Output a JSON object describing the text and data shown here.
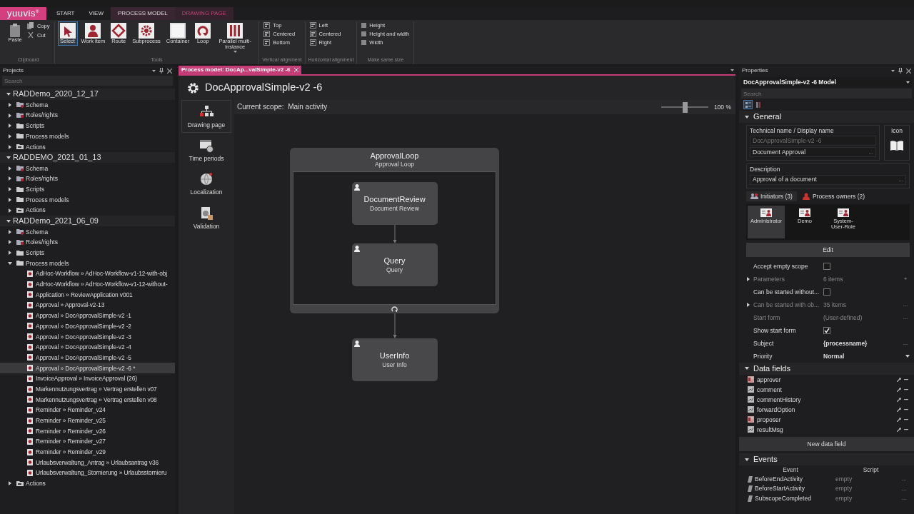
{
  "logo": "yuuvis$^{®}$",
  "ribbon_tabs": [
    {
      "label": "START",
      "kind": "plain",
      "selected": false
    },
    {
      "label": "VIEW",
      "kind": "plain",
      "selected": false
    },
    {
      "label": "PROCESS MODEL",
      "kind": "context",
      "selected": false
    },
    {
      "label": "DRAWING PAGE",
      "kind": "context",
      "selected": true
    }
  ],
  "ribbon_groups": [
    {
      "label": "Clipboard",
      "items": [
        {
          "label": "Paste",
          "kind": "large",
          "selected": false
        },
        {
          "label": "Copy",
          "kind": "small",
          "selected": false
        },
        {
          "label": "Cut",
          "kind": "small",
          "selected": false
        }
      ]
    },
    {
      "label": "Tools",
      "items": [
        {
          "label": "Select",
          "kind": "large",
          "selected": true
        },
        {
          "label": "Work item",
          "kind": "large",
          "selected": false
        },
        {
          "label": "Route",
          "kind": "large",
          "selected": false
        },
        {
          "label": "Subprocess",
          "kind": "large",
          "selected": false
        },
        {
          "label": "Container",
          "kind": "large",
          "selected": false
        },
        {
          "label": "Loop",
          "kind": "large",
          "selected": false
        },
        {
          "label": "Parallel multi-instance",
          "kind": "dropdown",
          "selected": false
        }
      ]
    },
    {
      "label": "Vertical alignment",
      "items": [
        {
          "label": "Top",
          "kind": "small",
          "selected": false
        },
        {
          "label": "Centered",
          "kind": "small",
          "selected": false
        },
        {
          "label": "Bottom",
          "kind": "small",
          "selected": false
        }
      ]
    },
    {
      "label": "Horizontal alignment",
      "items": [
        {
          "label": "Left",
          "kind": "small",
          "selected": false
        },
        {
          "label": "Centered",
          "kind": "small",
          "selected": false
        },
        {
          "label": "Right",
          "kind": "small",
          "selected": false
        }
      ]
    },
    {
      "label": "Make same size",
      "items": [
        {
          "label": "Height",
          "kind": "small",
          "selected": false
        },
        {
          "label": "Height and width",
          "kind": "small",
          "selected": false
        },
        {
          "label": "Width",
          "kind": "small",
          "selected": false
        }
      ]
    }
  ],
  "projects_panel": {
    "title": "Projects",
    "search_placeholder": "Search",
    "tree": [
      {
        "label": "RADDemo_2020_12_17",
        "kind": "project",
        "expanded": true,
        "selected": false,
        "children": [
          {
            "label": "Schema",
            "kind": "schema",
            "expanded": false,
            "selected": false
          },
          {
            "label": "Roles/rights",
            "kind": "roles",
            "expanded": false,
            "selected": false
          },
          {
            "label": "Scripts",
            "kind": "folder",
            "expanded": false,
            "selected": false
          },
          {
            "label": "Process models",
            "kind": "folder",
            "expanded": false,
            "selected": false
          },
          {
            "label": "Actions",
            "kind": "actions",
            "expanded": false,
            "selected": false
          }
        ]
      },
      {
        "label": "RADDEMO_2021_01_13",
        "kind": "project",
        "expanded": true,
        "selected": false,
        "children": [
          {
            "label": "Schema",
            "kind": "schema",
            "expanded": false,
            "selected": false
          },
          {
            "label": "Roles/rights",
            "kind": "roles",
            "expanded": false,
            "selected": false
          },
          {
            "label": "Scripts",
            "kind": "folder",
            "expanded": false,
            "selected": false
          },
          {
            "label": "Process models",
            "kind": "folder",
            "expanded": false,
            "selected": false
          },
          {
            "label": "Actions",
            "kind": "actions",
            "expanded": false,
            "selected": false
          }
        ]
      },
      {
        "label": "RADDemo_2021_06_09",
        "kind": "project",
        "expanded": true,
        "selected": false,
        "children": [
          {
            "label": "Schema",
            "kind": "schema",
            "expanded": false,
            "selected": false
          },
          {
            "label": "Roles/rights",
            "kind": "roles",
            "expanded": false,
            "selected": false
          },
          {
            "label": "Scripts",
            "kind": "folder",
            "expanded": false,
            "selected": false
          },
          {
            "label": "Process models",
            "kind": "folder",
            "expanded": true,
            "selected": false,
            "children": [
              {
                "label": "AdHoc-Workflow » AdHoc-Workflow-v1-12-with-obj",
                "kind": "model",
                "selected": false
              },
              {
                "label": "AdHoc-Workflow » AdHoc-Workflow-v1-12-without-",
                "kind": "model",
                "selected": false
              },
              {
                "label": "Application » ReviewApplication v001",
                "kind": "model",
                "selected": false
              },
              {
                "label": "Approval » Approval-v2-13",
                "kind": "model",
                "selected": false
              },
              {
                "label": "Approval » DocApprovalSimple-v2 -1",
                "kind": "model",
                "selected": false
              },
              {
                "label": "Approval » DocApprovalSimple-v2 -2",
                "kind": "model",
                "selected": false
              },
              {
                "label": "Approval » DocApprovalSimple-v2 -3",
                "kind": "model",
                "selected": false
              },
              {
                "label": "Approval » DocApprovalSimple-v2 -4",
                "kind": "model",
                "selected": false
              },
              {
                "label": "Approval » DocApprovalSimple-v2 -5",
                "kind": "model",
                "selected": false
              },
              {
                "label": "Approval » DocApprovalSimple-v2 -6 *",
                "kind": "model",
                "selected": true
              },
              {
                "label": "InvoiceApproval » InvoiceApproval (26)",
                "kind": "model",
                "selected": false
              },
              {
                "label": "Markennutzungsvertrag » Vertrag erstellen v07",
                "kind": "model",
                "selected": false
              },
              {
                "label": "Markennutzungsvertrag » Vertrag erstellen v08",
                "kind": "model",
                "selected": false
              },
              {
                "label": "Reminder » Reminder_v24",
                "kind": "model",
                "selected": false
              },
              {
                "label": "Reminder » Reminder_v25",
                "kind": "model",
                "selected": false
              },
              {
                "label": "Reminder » Reminder_v26",
                "kind": "model",
                "selected": false
              },
              {
                "label": "Reminder » Reminder_v27",
                "kind": "model",
                "selected": false
              },
              {
                "label": "Reminder » Reminder_v29",
                "kind": "model",
                "selected": false
              },
              {
                "label": "Urlaubsverwaltung_Antrag » Urlaubsantrag v36",
                "kind": "model",
                "selected": false
              },
              {
                "label": "Urlaubsverwaltung_Stornierung » Urlaubsstornieru",
                "kind": "model",
                "selected": false
              }
            ]
          },
          {
            "label": "Actions",
            "kind": "actions",
            "expanded": false,
            "selected": false
          }
        ]
      }
    ]
  },
  "document_tab": {
    "label": "Process model: DocAp...valSimple-v2 -6",
    "selected": true
  },
  "model_title": "DocApprovalSimple-v2 -6",
  "side_nav": [
    {
      "label": "Drawing page",
      "selected": true
    },
    {
      "label": "Time periods",
      "selected": false
    },
    {
      "label": "Localization",
      "selected": false
    },
    {
      "label": "Validation",
      "selected": false
    }
  ],
  "scope_label": "Current scope:  Main activity",
  "zoom": {
    "level": 0.5,
    "reading": "100 %"
  },
  "diagram": {
    "container": {
      "title": "ApprovalLoop",
      "subtitle": "Approval Loop",
      "children": [
        {
          "title": "DocumentReview",
          "subtitle": "Document Review"
        },
        {
          "title": "Query",
          "subtitle": "Query"
        }
      ]
    },
    "nodes": [
      {
        "title": "UserInfo",
        "subtitle": "User Info"
      }
    ]
  },
  "properties_panel": {
    "title": "Properties",
    "object": "DocApprovalSimple-v2 -6 Model",
    "search_placeholder": "Search",
    "view_toggles": [
      {
        "kind": "categorized",
        "selected": true
      },
      {
        "kind": "alphabetical",
        "selected": false
      }
    ],
    "general": {
      "title": "General",
      "expanded": true,
      "name_group": {
        "label": "Technical name / Display name",
        "technical_name": "DocApprovalSimple-v2 -6",
        "display_name": "Document Approval",
        "action": "..."
      },
      "icon_label": "Icon",
      "description": {
        "label": "Description",
        "value": "Approval of a document",
        "action": "..."
      },
      "tabs": [
        {
          "label": "Initiators (3)",
          "selected": true
        },
        {
          "label": "Process owners (2)",
          "selected": false
        }
      ],
      "roles": [
        {
          "label": "Administrator",
          "selected": true
        },
        {
          "label": "Demo",
          "selected": false
        },
        {
          "label": "System-User-Role",
          "selected": false
        }
      ],
      "edit_button": "Edit",
      "rows": [
        {
          "label": "Accept empty scope",
          "kind": "checkbox",
          "checked": false,
          "disabled": false
        },
        {
          "label": "Parameters",
          "kind": "text",
          "value": "6 items",
          "action": "+",
          "disabled": true,
          "expanded": false
        },
        {
          "label": "Can be started without...",
          "kind": "checkbox",
          "checked": false,
          "disabled": false
        },
        {
          "label": "Can be started with ob...",
          "kind": "text",
          "value": "35 items",
          "action": "...",
          "disabled": true,
          "expanded": false
        },
        {
          "label": "Start form",
          "kind": "text",
          "value": "(User-defined)",
          "action": "...",
          "disabled": true
        },
        {
          "label": "Show start form",
          "kind": "checkbox",
          "checked": true,
          "disabled": false
        },
        {
          "label": "Subject",
          "kind": "text",
          "value": "{processname}",
          "action": "...",
          "disabled": false
        },
        {
          "label": "Priority",
          "kind": "dropdown",
          "value": "Normal",
          "disabled": false
        }
      ]
    },
    "data_fields": {
      "title": "Data fields",
      "expanded": true,
      "items": [
        {
          "name": "approver",
          "kind": "user"
        },
        {
          "name": "comment",
          "kind": "text"
        },
        {
          "name": "commentHistory",
          "kind": "text"
        },
        {
          "name": "forwardOption",
          "kind": "text"
        },
        {
          "name": "proposer",
          "kind": "user"
        },
        {
          "name": "resultMsg",
          "kind": "text"
        }
      ],
      "new_button": "New data field"
    },
    "events": {
      "title": "Events",
      "expanded": true,
      "columns": [
        "Event",
        "Script"
      ],
      "rows": [
        {
          "event": "BeforeEndActivity",
          "script": "empty",
          "action": "..."
        },
        {
          "event": "BeforeStartActivity",
          "script": "empty",
          "action": "..."
        },
        {
          "event": "SubscopeCompleted",
          "script": "empty",
          "action": "..."
        }
      ]
    }
  }
}
